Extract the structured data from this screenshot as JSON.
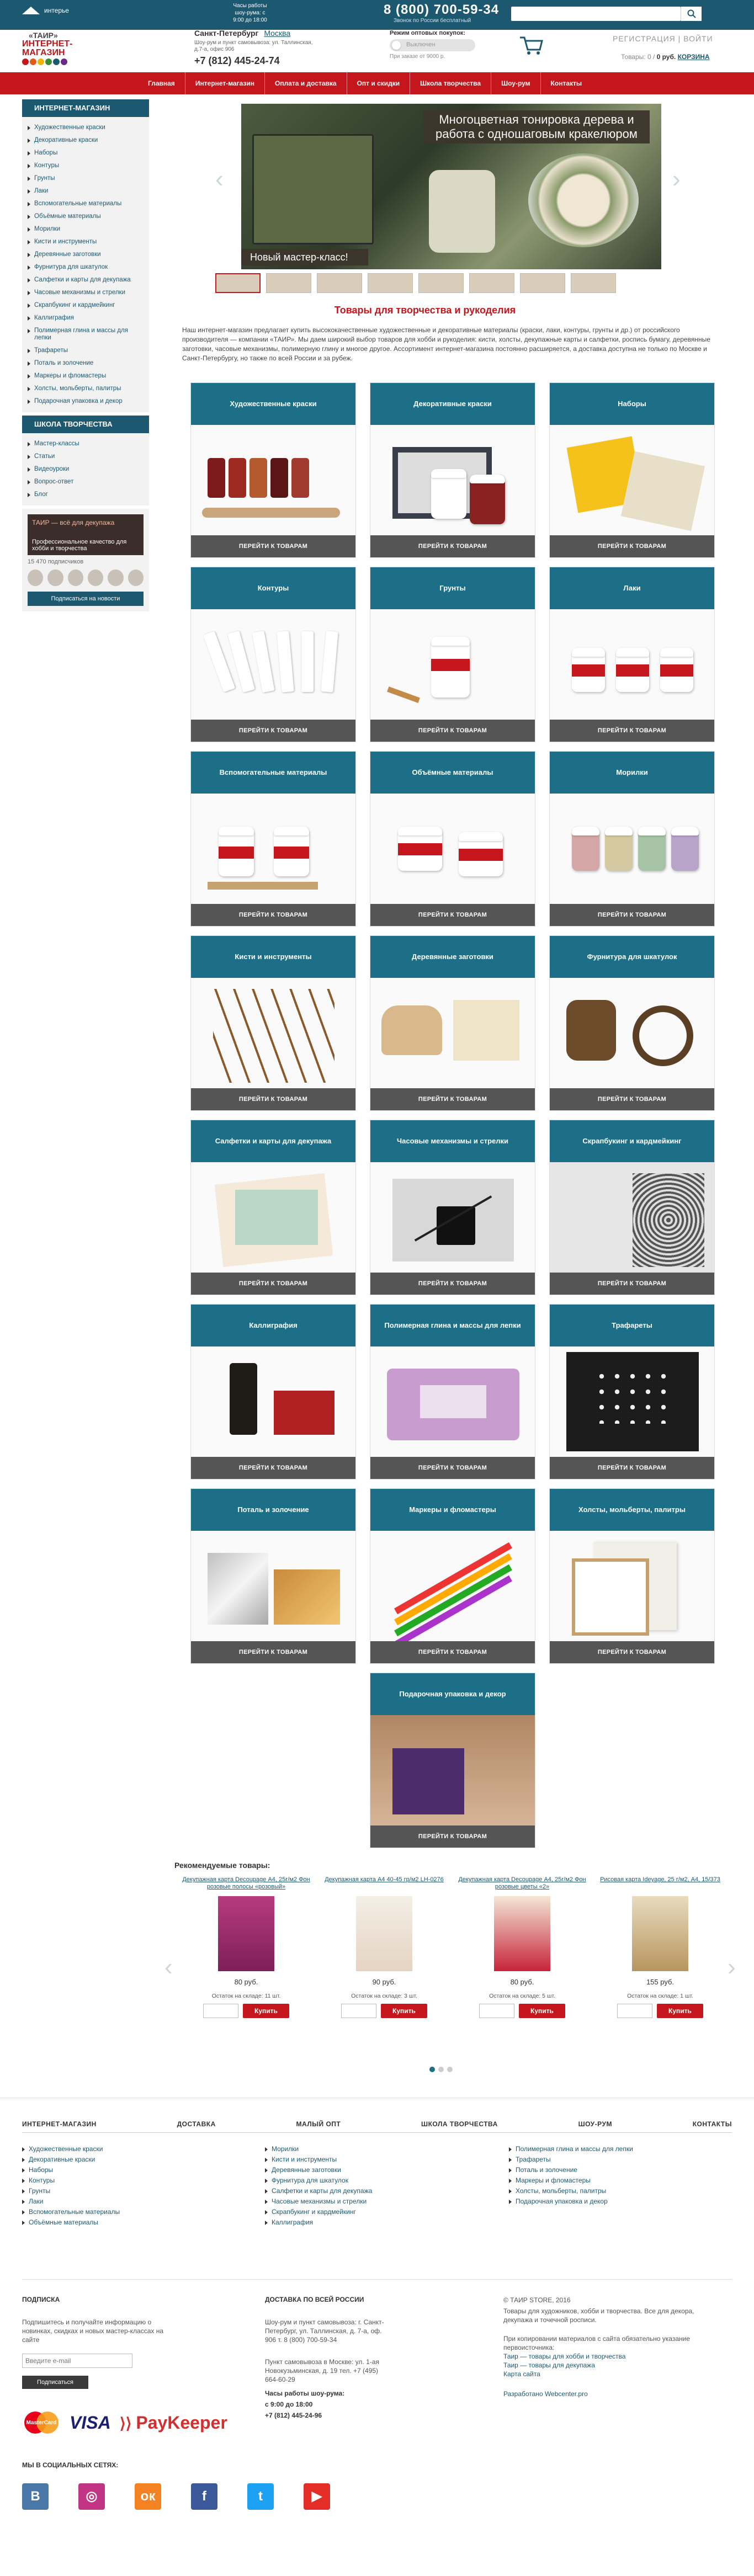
{
  "top": {
    "tagline": "интерье",
    "hours": "Часы работы шоу-рума: с 9:00 до 18:00",
    "phone": "8 (800) 700-59-34",
    "phone_sub": "Звонок по России бесплатный",
    "search_placeholder": ""
  },
  "header": {
    "logo_l1": "«ТАИР»",
    "logo_l2": "ИНТЕРНЕТ-",
    "logo_l3": "МАГАЗИН",
    "city_label": "Санкт-Петербург",
    "city_alt": "Москва",
    "address": "Шоу-рум и пункт самовывоза: ул. Таллинская, д.7-а, офис 906",
    "phone": "+7 (812) 445-24-74",
    "wholesale_title": "Режим оптовых покупок:",
    "wholesale_state": "Выключен",
    "wholesale_note": "При заказе от 9000 р.",
    "auth": "РЕГИСТРАЦИЯ | ВОЙТИ",
    "cart_label": "Товары: 0 / ",
    "cart_sum": "0 руб.",
    "cart_link": "КОРЗИНА"
  },
  "nav": [
    "Главная",
    "Интернет-магазин",
    "Оплата и доставка",
    "Опт и скидки",
    "Школа творчества",
    "Шоу-рум",
    "Контакты"
  ],
  "sidebar": {
    "shop_title": "ИНТЕРНЕТ-МАГАЗИН",
    "shop_items": [
      "Художественные краски",
      "Декоративные краски",
      "Наборы",
      "Контуры",
      "Грунты",
      "Лаки",
      "Вспомогательные материалы",
      "Объёмные материалы",
      "Морилки",
      "Кисти и инструменты",
      "Деревянные заготовки",
      "Фурнитура для шкатулок",
      "Салфетки и карты для декупажа",
      "Часовые механизмы и стрелки",
      "Скрапбукинг и кардмейкинг",
      "Каллиграфия",
      "Полимерная глина и массы для лепки",
      "Трафареты",
      "Поталь и золочение",
      "Маркеры и фломастеры",
      "Холсты, мольберты, палитры",
      "Подарочная упаковка и декор"
    ],
    "school_title": "ШКОЛА ТВОРЧЕСТВА",
    "school_items": [
      "Мастер-классы",
      "Статьи",
      "Видеоуроки",
      "Вопрос-ответ",
      "Блог"
    ],
    "vk_banner": "ТАИР — всё для декупажа",
    "vk_banner_sub": "Профессиональное качество для хобби и творчества",
    "vk_followers": "15 470 подписчиков",
    "vk_button": "Подписаться на новости"
  },
  "slider": {
    "caption": "Многоцветная тонировка дерева и работа с одношаговым кракелюром",
    "sub": "Новый мастер-класс!"
  },
  "intro": {
    "title": "Товары для творчества и рукоделия",
    "text": "Наш интернет-магазин предлагает купить высококачественные художественные и декоративные материалы (краски, лаки, контуры, грунты и др.) от российского производителя — компании «ТАИР». Мы даем широкий выбор товаров для хобби и рукоделия: кисти, холсты, декупажные карты и салфетки, роспись бумагу, деревянные заготовки, часовые механизмы, полимерную глину и многое другое. Ассортимент интернет-магазина постоянно расширяется, а доставка доступна не только по Москве и Санкт-Петербургу, но также по всей России и за рубеж."
  },
  "categories": [
    {
      "title": "Художественные краски",
      "button": "ПЕРЕЙТИ К ТОВАРАМ"
    },
    {
      "title": "Декоративные краски",
      "button": "ПЕРЕЙТИ К ТОВАРАМ"
    },
    {
      "title": "Наборы",
      "button": "ПЕРЕЙТИ К ТОВАРАМ"
    },
    {
      "title": "Контуры",
      "button": "ПЕРЕЙТИ К ТОВАРАМ"
    },
    {
      "title": "Грунты",
      "button": "ПЕРЕЙТИ К ТОВАРАМ"
    },
    {
      "title": "Лаки",
      "button": "ПЕРЕЙТИ К ТОВАРАМ"
    },
    {
      "title": "Вспомогательные материалы",
      "button": "ПЕРЕЙТИ К ТОВАРАМ"
    },
    {
      "title": "Объёмные материалы",
      "button": "ПЕРЕЙТИ К ТОВАРАМ"
    },
    {
      "title": "Морилки",
      "button": "ПЕРЕЙТИ К ТОВАРАМ"
    },
    {
      "title": "Кисти и инструменты",
      "button": "ПЕРЕЙТИ К ТОВАРАМ"
    },
    {
      "title": "Деревянные заготовки",
      "button": "ПЕРЕЙТИ К ТОВАРАМ"
    },
    {
      "title": "Фурнитура для шкатулок",
      "button": "ПЕРЕЙТИ К ТОВАРАМ"
    },
    {
      "title": "Салфетки и карты для декупажа",
      "button": "ПЕРЕЙТИ К ТОВАРАМ"
    },
    {
      "title": "Часовые механизмы и стрелки",
      "button": "ПЕРЕЙТИ К ТОВАРАМ"
    },
    {
      "title": "Скрапбукинг и кардмейкинг",
      "button": "ПЕРЕЙТИ К ТОВАРАМ"
    },
    {
      "title": "Каллиграфия",
      "button": "ПЕРЕЙТИ К ТОВАРАМ"
    },
    {
      "title": "Полимерная глина и массы для лепки",
      "button": "ПЕРЕЙТИ К ТОВАРАМ"
    },
    {
      "title": "Трафареты",
      "button": "ПЕРЕЙТИ К ТОВАРАМ"
    },
    {
      "title": "Поталь и золочение",
      "button": "ПЕРЕЙТИ К ТОВАРАМ"
    },
    {
      "title": "Маркеры и фломастеры",
      "button": "ПЕРЕЙТИ К ТОВАРАМ"
    },
    {
      "title": "Холсты, мольберты, палитры",
      "button": "ПЕРЕЙТИ К ТОВАРАМ"
    },
    {
      "title": "Подарочная упаковка и декор",
      "button": "ПЕРЕЙТИ К ТОВАРАМ"
    }
  ],
  "recommended": {
    "title": "Рекомендуемые товары:",
    "products": [
      {
        "name": "Декупажная карта Decoupage А4, 25г/м2 Фон розовые полосы «розовый»",
        "price": "80 руб.",
        "stock": "Остаток на складе: 11 шт.",
        "qty": "",
        "buy": "Купить"
      },
      {
        "name": "Декупажная карта А4 40-45 гр/м2 LH-0276",
        "price": "90 руб.",
        "stock": "Остаток на складе: 3 шт.",
        "qty": "",
        "buy": "Купить"
      },
      {
        "name": "Декупажная карта Decoupage А4, 25г/м2 Фон розовые цветы «2»",
        "price": "80 руб.",
        "stock": "Остаток на складе: 5 шт.",
        "qty": "",
        "buy": "Купить"
      },
      {
        "name": "Рисовая карта Ideyage, 25 г/м2, А4, 15/373",
        "price": "155 руб.",
        "stock": "Остаток на складе: 1 шт.",
        "qty": "",
        "buy": "Купить"
      }
    ]
  },
  "footer": {
    "nav": [
      "ИНТЕРНЕТ-МАГАЗИН",
      "ДОСТАВКА",
      "МАЛЫЙ ОПТ",
      "ШКОЛА ТВОРЧЕСТВА",
      "ШОУ-РУМ",
      "КОНТАКТЫ"
    ],
    "col1": [
      "Художественные краски",
      "Декоративные краски",
      "Наборы",
      "Контуры",
      "Грунты",
      "Лаки",
      "Вспомогательные материалы",
      "Объёмные материалы"
    ],
    "col2": [
      "Морилки",
      "Кисти и инструменты",
      "Деревянные заготовки",
      "Фурнитура для шкатулок",
      "Салфетки и карты для декупажа",
      "Часовые механизмы и стрелки",
      "Скрапбукинг и кардмейкинг",
      "Каллиграфия"
    ],
    "col3": [
      "Полимерная глина и массы для лепки",
      "Трафареты",
      "Поталь и золочение",
      "Маркеры и фломастеры",
      "Холсты, мольберты, палитры",
      "Подарочная упаковка и декор"
    ],
    "subscribe_title": "ПОДПИСКА",
    "subscribe_text": "Подпишитесь и получайте информацию о новинках, скидках и новых мастер-классах на сайте",
    "email_placeholder": "Введите e-mail",
    "subscribe_button": "Подписаться",
    "delivery_title": "ДОСТАВКА ПО ВСЕЙ РОССИИ",
    "delivery_text": "Шоу-рум и пункт самовывоза: г. Санкт-Петербург, ул. Таллинская, д. 7-а, оф. 906 т. 8 (800) 700-59-34",
    "delivery_text2": "Пункт самовывоза в Москве: ул. 1-ая Новокузьминская, д. 19 тел. +7 (495) 664-60-29",
    "hours_title": "Часы работы шоу-рума:",
    "hours_text": "с 9:00 до 18:00",
    "hours_phone": "+7 (812) 445-24-96",
    "copyright": "© ТАИР STORE, 2016",
    "about": "Товары для художников, хобби и творчества. Все для декора, декупажа и точечной росписи.",
    "copy_note": "При копировании материалов с сайта обязательно указание первоисточника:",
    "links": [
      "Таир — товары для хобби и творчества",
      "Таир — товары для декупажа",
      "Карта сайта"
    ],
    "dev": "Разработано Webcenter.pro",
    "social_title": "МЫ В СОЦИАЛЬНЫХ СЕТЯХ:",
    "payments": {
      "mc": "MasterCard",
      "visa": "VISA",
      "pk": "PayKeeper"
    }
  },
  "colors": {
    "brand_red": "#c4161c",
    "brand_blue": "#1d5871",
    "card_head": "#1d6f87"
  }
}
